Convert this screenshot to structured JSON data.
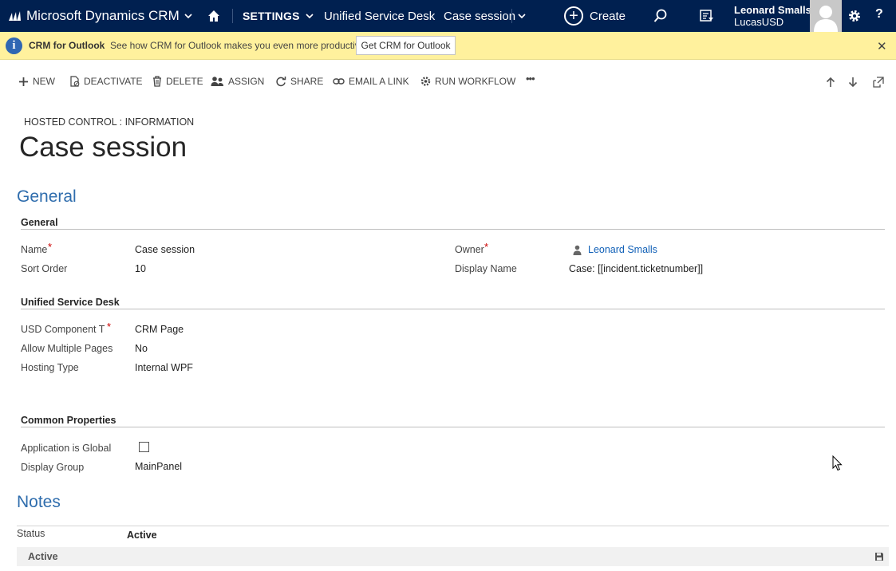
{
  "topbar": {
    "app_title": "Microsoft Dynamics CRM",
    "nav_settings": "SETTINGS",
    "nav_area": "Unified Service Desk",
    "nav_record": "Case session",
    "create_label": "Create",
    "user_name": "Leonard Smalls",
    "user_org": "LucasUSD",
    "help_label": "?"
  },
  "notification": {
    "title": "CRM for Outlook",
    "message": "See how CRM for Outlook makes you even more productive.",
    "button_label": "Get CRM for Outlook",
    "close_glyph": "✕",
    "info_glyph": "i"
  },
  "commands": {
    "new": "NEW",
    "deactivate": "DEACTIVATE",
    "delete": "DELETE",
    "assign": "ASSIGN",
    "share": "SHARE",
    "email_link": "EMAIL A LINK",
    "run_workflow": "RUN WORKFLOW",
    "more": "•••"
  },
  "header": {
    "entity_breadcrumb": "HOSTED CONTROL : INFORMATION",
    "record_title": "Case session"
  },
  "general_tab": {
    "title": "General",
    "section_general": {
      "title": "General",
      "name_label": "Name",
      "name_value": "Case session",
      "sort_order_label": "Sort Order",
      "sort_order_value": "10",
      "owner_label": "Owner",
      "owner_value": "Leonard Smalls",
      "display_name_label": "Display Name",
      "display_name_value": "Case: [[incident.ticketnumber]]"
    },
    "section_usd": {
      "title": "Unified Service Desk",
      "component_type_label": "USD Component T",
      "component_type_value": "CRM Page",
      "allow_multiple_label": "Allow Multiple Pages",
      "allow_multiple_value": "No",
      "hosting_type_label": "Hosting Type",
      "hosting_type_value": "Internal WPF"
    },
    "section_common": {
      "title": "Common Properties",
      "app_global_label": "Application is Global",
      "app_global_checked": false,
      "display_group_label": "Display Group",
      "display_group_value": "MainPanel"
    }
  },
  "notes_tab": {
    "title": "Notes"
  },
  "footer": {
    "status_label": "Status",
    "status_value": "Active",
    "statusbar_text": "Active"
  },
  "required_marker": "*",
  "colors": {
    "navbar": "#002050",
    "notification": "#fff19d",
    "tab_title": "#2f6dad",
    "link": "#1160b7",
    "required": "#cc0000"
  }
}
